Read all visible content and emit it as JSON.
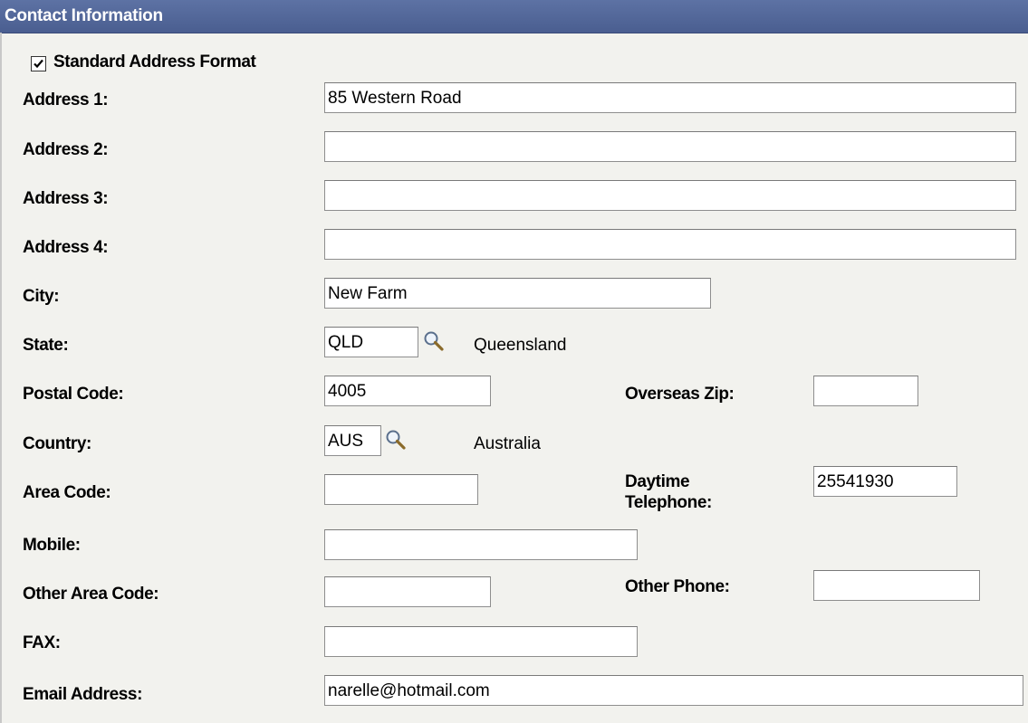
{
  "header": {
    "title": "Contact Information"
  },
  "standard_address": {
    "label": "Standard Address Format",
    "checked": true
  },
  "fields": {
    "address1": {
      "label": "Address 1:",
      "value": "85 Western Road"
    },
    "address2": {
      "label": "Address 2:",
      "value": ""
    },
    "address3": {
      "label": "Address 3:",
      "value": ""
    },
    "address4": {
      "label": "Address 4:",
      "value": ""
    },
    "city": {
      "label": "City:",
      "value": "New Farm"
    },
    "state": {
      "label": "State:",
      "value": "QLD",
      "description": "Queensland"
    },
    "postal_code": {
      "label": "Postal Code:",
      "value": "4005"
    },
    "overseas_zip": {
      "label": "Overseas Zip:",
      "value": ""
    },
    "country": {
      "label": "Country:",
      "value": "AUS",
      "description": "Australia"
    },
    "area_code": {
      "label": "Area Code:",
      "value": ""
    },
    "daytime_telephone": {
      "label": "Daytime Telephone:",
      "value": "25541930"
    },
    "mobile": {
      "label": "Mobile:",
      "value": ""
    },
    "other_area_code": {
      "label": "Other Area Code:",
      "value": ""
    },
    "other_phone": {
      "label": "Other Phone:",
      "value": ""
    },
    "fax": {
      "label": "FAX:",
      "value": ""
    },
    "email": {
      "label": "Email Address:",
      "value": "narelle@hotmail.com"
    }
  },
  "icons": {
    "lookup": "magnifier-icon",
    "checkbox": "checkmark-icon"
  },
  "colors": {
    "header_bg": "#4a5e90",
    "page_bg": "#f2f2ee",
    "field_border": "#8e8e8e"
  }
}
